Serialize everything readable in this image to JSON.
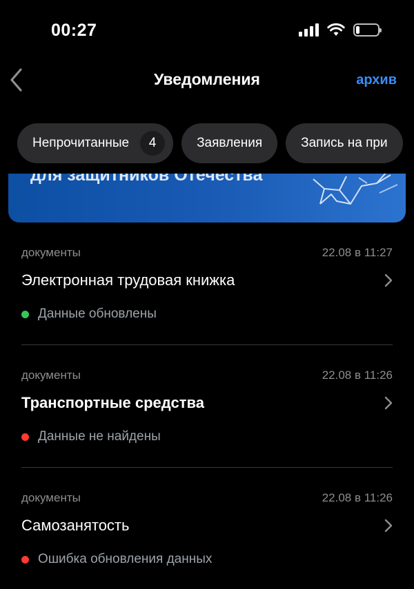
{
  "status_bar": {
    "time": "00:27",
    "icons": [
      "cellular-signal-icon",
      "wifi-icon",
      "battery-icon"
    ],
    "battery_level": 0.15
  },
  "nav": {
    "back_icon": "chevron-left-icon",
    "title": "Уведомления",
    "archive_label": "архив"
  },
  "chips": [
    {
      "label": "Непрочитанные",
      "count": "4"
    },
    {
      "label": "Заявления"
    },
    {
      "label": "Запись на при"
    }
  ],
  "banner": {
    "text": "для защитников Отечества"
  },
  "notifications": [
    {
      "category": "документы",
      "time": "22.08 в 11:27",
      "title": "Электронная трудовая книжка",
      "status": "Данные обновлены",
      "status_color": "#34c759",
      "unread": false
    },
    {
      "category": "документы",
      "time": "22.08 в 11:26",
      "title": "Транспортные средства",
      "status": "Данные не найдены",
      "status_color": "#ff3b30",
      "unread": true
    },
    {
      "category": "документы",
      "time": "22.08 в 11:26",
      "title": "Самозанятость",
      "status": "Ошибка обновления данных",
      "status_color": "#ff3b30",
      "unread": false
    }
  ],
  "colors": {
    "background": "#000000",
    "accent": "#3a8cf5",
    "chip_bg": "#2c2c2e",
    "secondary_text": "#8e8e93"
  }
}
